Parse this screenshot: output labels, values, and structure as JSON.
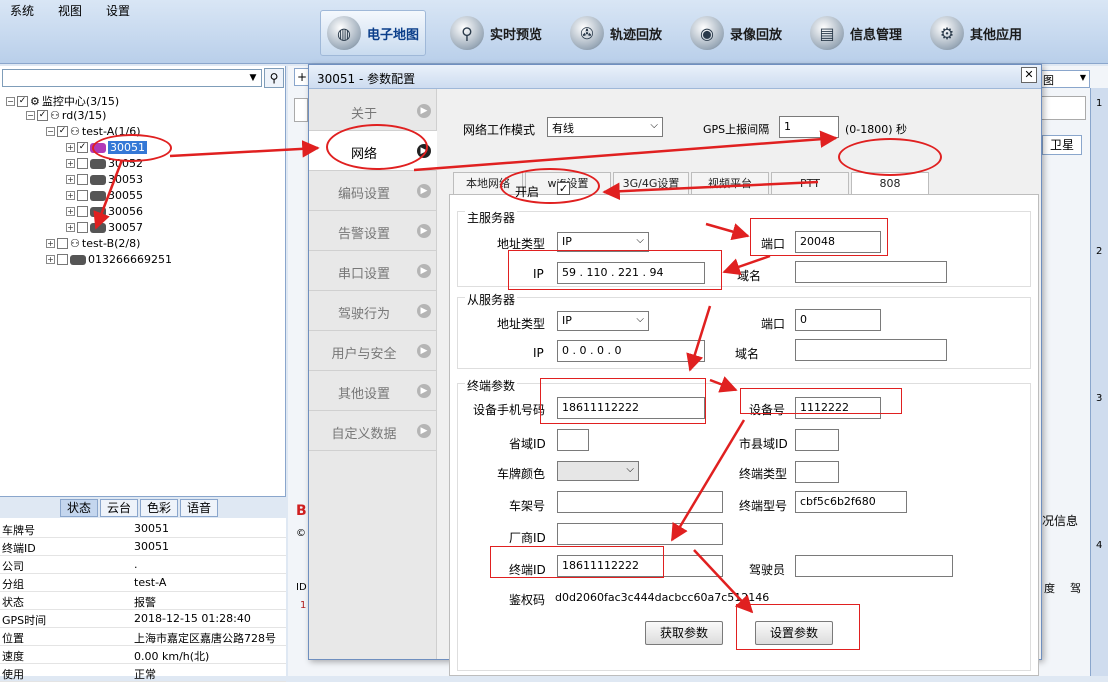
{
  "menu": [
    "系统",
    "视图",
    "设置"
  ],
  "top_buttons": [
    {
      "label": "电子地图",
      "icon": "globe-icon"
    },
    {
      "label": "实时预览",
      "icon": "magnifier-icon"
    },
    {
      "label": "轨迹回放",
      "icon": "track-icon"
    },
    {
      "label": "录像回放",
      "icon": "video-icon"
    },
    {
      "label": "信息管理",
      "icon": "info-icon"
    },
    {
      "label": "其他应用",
      "icon": "gear-icon"
    }
  ],
  "tree": {
    "root": "监控中心(3/15)",
    "group": "rd(3/15)",
    "sub_a": "test-A(1/6)",
    "vehicles": [
      "30051",
      "30052",
      "30053",
      "30055",
      "30056",
      "30057"
    ],
    "sub_b": "test-B(2/8)",
    "phone": "013266669251"
  },
  "status_tabs": [
    "状态",
    "云台",
    "色彩",
    "语音"
  ],
  "info": [
    {
      "k": "车牌号",
      "v": "30051"
    },
    {
      "k": "终端ID",
      "v": "30051"
    },
    {
      "k": "公司",
      "v": "."
    },
    {
      "k": "分组",
      "v": "test-A"
    },
    {
      "k": "状态",
      "v": "报警"
    },
    {
      "k": "GPS时间",
      "v": "2018-12-15 01:28:40"
    },
    {
      "k": "位置",
      "v": "上海市嘉定区嘉唐公路728号"
    },
    {
      "k": "速度",
      "v": "0.00 km/h(北)"
    },
    {
      "k": "使用",
      "v": "正常"
    }
  ],
  "bg": {
    "satellite": "卫星",
    "info_label": "况信息",
    "id_col": "ID",
    "one": "1",
    "drive": "驾",
    "B": "B",
    "c": "© :",
    "nums": [
      "1",
      "2",
      "3",
      "4"
    ],
    "duo": "度",
    "map_tab": "图"
  },
  "dialog": {
    "title": "30051 - 参数配置",
    "nav": [
      "关于",
      "网络",
      "编码设置",
      "告警设置",
      "串口设置",
      "驾驶行为",
      "用户与安全",
      "其他设置",
      "自定义数据"
    ],
    "net_mode_label": "网络工作模式",
    "net_mode": "有线",
    "gps_label": "GPS上报间隔",
    "gps_value": "1",
    "gps_range": "(0-1800) 秒",
    "tabs": [
      "本地网络",
      "wifi设置",
      "3G/4G设置",
      "视频平台",
      "PTT",
      "808"
    ],
    "enable_label": "开启",
    "main_server": "主服务器",
    "addr_type_label": "地址类型",
    "addr_type": "IP",
    "port_label": "端口",
    "main_port": "20048",
    "ip_label": "IP",
    "main_ip": "59   .  110   .  221   .   94",
    "domain_label": "域名",
    "backup_server": "从服务器",
    "backup_port": "0",
    "backup_ip": "0    .    0    .    0    .    0",
    "terminal_params": "终端参数",
    "phone_label": "设备手机号码",
    "phone_value": "18611112222",
    "device_label": "设备号",
    "device_value": "1112222",
    "province_label": "省域ID",
    "city_label": "市县域ID",
    "plate_color_label": "车牌颜色",
    "terminal_type_label": "终端类型",
    "frame_label": "车架号",
    "model_label": "终端型号",
    "model_value": "cbf5c6b2f680",
    "vendor_label": "厂商ID",
    "terminal_id_label": "终端ID",
    "terminal_id_value": "18611112222",
    "driver_label": "驾驶员",
    "auth_label": "鉴权码",
    "auth_value": "d0d2060fac3c444dacbcc60a7c512146",
    "get_btn": "获取参数",
    "set_btn": "设置参数"
  },
  "colors": {
    "accent": "#e02020",
    "selected": "#3478d6"
  }
}
